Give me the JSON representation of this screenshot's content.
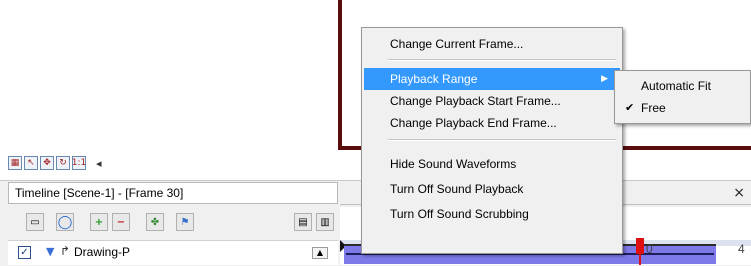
{
  "context_menu": {
    "items": [
      {
        "label": "Change Current Frame..."
      },
      {
        "label": "Playback Range",
        "highlighted": true,
        "has_submenu": true
      },
      {
        "label": "Change Playback Start Frame..."
      },
      {
        "label": "Change Playback End Frame..."
      },
      {
        "label": "Hide Sound Waveforms"
      },
      {
        "label": "Turn Off Sound Playback"
      },
      {
        "label": "Turn Off Sound Scrubbing"
      }
    ],
    "submenu_arrow": "▶"
  },
  "submenu": {
    "items": [
      {
        "label": "Automatic Fit",
        "checked": false
      },
      {
        "label": "Free",
        "checked": true,
        "check_mark": "✔"
      }
    ]
  },
  "toolbar_row": {
    "buttons": [
      "grid-icon",
      "select-icon",
      "transform-icon",
      "rotate-icon",
      "one-to-one-icon"
    ],
    "one_to_one_label": "1:1",
    "arrow": "◂"
  },
  "timeline": {
    "title": "Timeline [Scene-1] - [Frame 30]",
    "close_glyph": "×",
    "layer": {
      "name": "Drawing-P",
      "checked": true,
      "check_glyph": "✓",
      "expand_glyph": "▼",
      "curve_glyph": "↱"
    },
    "ruler_ticks": {
      "tick_10": "0",
      "tick_40": "4"
    },
    "scroll_up_glyph": "▲"
  },
  "colors": {
    "menu_highlight": "#3399ff",
    "stage_border": "#5a0d0d",
    "range_bar": "#7e79e8",
    "playhead": "#e01010"
  }
}
